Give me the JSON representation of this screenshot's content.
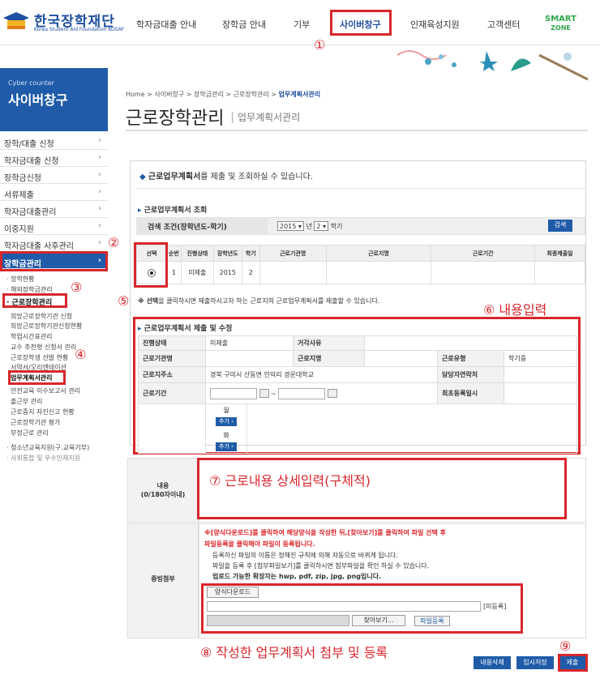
{
  "header": {
    "logo_text": "한국장학재단",
    "logo_sub": "Korea Student Aid Foundation KOSAF",
    "nav": [
      "학자금대출 안내",
      "장학금 안내",
      "기부",
      "사이버창구",
      "인재육성지원",
      "고객센터"
    ],
    "smart_line1": "SMART",
    "smart_line2": "ZONE"
  },
  "sidebar": {
    "head_small": "Cyber counter",
    "head_title": "사이버창구",
    "menu": [
      "장학/대출 신청",
      "학자금대출 신청",
      "장학금신청",
      "서류제출",
      "학자금대출관리",
      "이중지원",
      "학자금대출 사후관리",
      "장학금관리"
    ],
    "arrow": "›",
    "sub_top": [
      "· 장학현황",
      "· 해외장학금관리",
      "· 근로장학관리"
    ],
    "sub_items": [
      "희망근로장학기관 신청",
      "희망근로장학기관신청현황",
      "학업시간표관리",
      "교수 추천형 신청서 관리",
      "근로장학생 선발 현황",
      "서약서/오리엔테이션",
      "업무계획서관리",
      "안전교육 이수보고서 관리",
      "출근부 관리",
      "근로중지 자진신고 현황",
      "근로장학기관 평가",
      "부정근로 관리"
    ],
    "sub_bottom": [
      "· 청소년교육지원(구.교육기부)",
      "· 사회통합 및 우수인재지원"
    ]
  },
  "breadcrumb": {
    "path": "Home > 사이버창구 > 장학금관리 > 근로장학관리 > ",
    "current": "업무계획서관리"
  },
  "page": {
    "title": "근로장학관리",
    "subtitle": "업무계획서관리",
    "intro_bold": "근로업무계획서",
    "intro_rest": "를 제출 및 조회하실 수 있습니다."
  },
  "search": {
    "section_title": "근로업무계획서 조회",
    "label": "검색 조건(장학년도-학기)",
    "year": "2015",
    "year_unit": "년",
    "term": "2",
    "term_unit": "학기",
    "button": "검색"
  },
  "result_table": {
    "headers": [
      "선택",
      "순번",
      "진행상태",
      "장학년도",
      "학기",
      "근로기관명",
      "근로지명",
      "근로기간",
      "최종제출일"
    ],
    "row": [
      "",
      "1",
      "미제출",
      "2015",
      "2",
      "",
      "",
      "",
      ""
    ]
  },
  "notice": {
    "text_bold": "※ 선택",
    "text_rest": "을 클릭하시면 제출하시고자 하는 근로지의 근로업무계획서를 제출할 수 있습니다."
  },
  "form": {
    "section_title": "근로업무계획서 제출 및 수정",
    "labels": {
      "status": "진행상태",
      "reject": "거각사유",
      "org": "근로기관명",
      "place": "근로지명",
      "type": "근로유형",
      "addr": "근로지주소",
      "manager_phone": "담당자연락처",
      "period": "근로기간",
      "last_reg": "최초등록일시"
    },
    "values": {
      "status": "미제출",
      "type": "학기중",
      "addr": "경북 구미시 산동면 인덕리 경운대학교"
    },
    "tilde": "~",
    "month": "월",
    "day": "화",
    "add_button": "추가 ›"
  },
  "content": {
    "label": "내용",
    "limit": "(0/180자이내)"
  },
  "attach": {
    "label": "증빙첨부",
    "note_line1": "※[양식다운로드]를 클릭하여 해당양식을 작성한 뒤,[찾아보기]를 클릭하여 파일 선택 후",
    "note_line2": "파일등록을 클릭해야 파일이 등록됩니다.",
    "note_line3": "등록하신 파일의 이름은 정해진 규칙에 의해 자동으로 바뀌게 됩니다.",
    "note_line4": "파일을 등록 후 [첨부파일보기]를 클릭하시면 첨부파일을 확인 하실 수 있습니다.",
    "note_line5": "업로드 가능한 확장자는 hwp, pdf, zip, jpg, png입니다.",
    "download_button": "양식다운로드",
    "unregistered": "[미등록]",
    "browse_button": "찾아보기...",
    "register_button": "파일등록"
  },
  "buttons": {
    "delete": "내용삭제",
    "temp_save": "임시저장",
    "submit": "제출"
  },
  "annotations": {
    "n1": "①",
    "n2": "②",
    "n3": "③",
    "n4": "④",
    "n5": "⑤",
    "n6": "⑥ 내용입력",
    "n7": "⑦ 근로내용 상세입력(구체적)",
    "n8": "⑧ 작성한 업무계획서 첨부 및 등록",
    "n9": "⑨"
  },
  "colors": {
    "primary": "#1f5ba8",
    "annotation_red": "#d9262c",
    "smart_green": "#2ea84a"
  }
}
